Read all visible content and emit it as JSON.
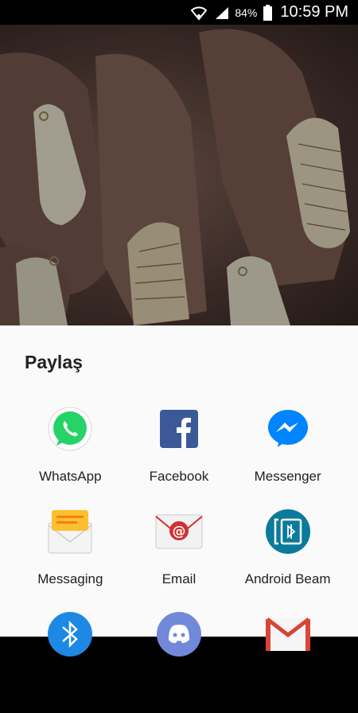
{
  "status_bar": {
    "battery_percent": "84%",
    "time": "10:59 PM"
  },
  "share_sheet": {
    "title": "Paylaş",
    "apps": [
      {
        "label": "WhatsApp",
        "icon": "whatsapp-icon"
      },
      {
        "label": "Facebook",
        "icon": "facebook-icon"
      },
      {
        "label": "Messenger",
        "icon": "messenger-icon"
      },
      {
        "label": "Messaging",
        "icon": "messaging-icon"
      },
      {
        "label": "Email",
        "icon": "email-icon"
      },
      {
        "label": "Android Beam",
        "icon": "android-beam-icon"
      },
      {
        "label": "",
        "icon": "bluetooth-icon"
      },
      {
        "label": "",
        "icon": "discord-icon"
      },
      {
        "label": "",
        "icon": "gmail-icon"
      }
    ]
  },
  "colors": {
    "status_bar_bg": "#000000",
    "sheet_bg": "#fafafa",
    "whatsapp": "#25d366",
    "facebook": "#3b5998",
    "messenger": "#0084ff",
    "email_red": "#d32f2f",
    "android_beam": "#0b7a9b",
    "bluetooth": "#1e88e5",
    "discord": "#7289da"
  }
}
